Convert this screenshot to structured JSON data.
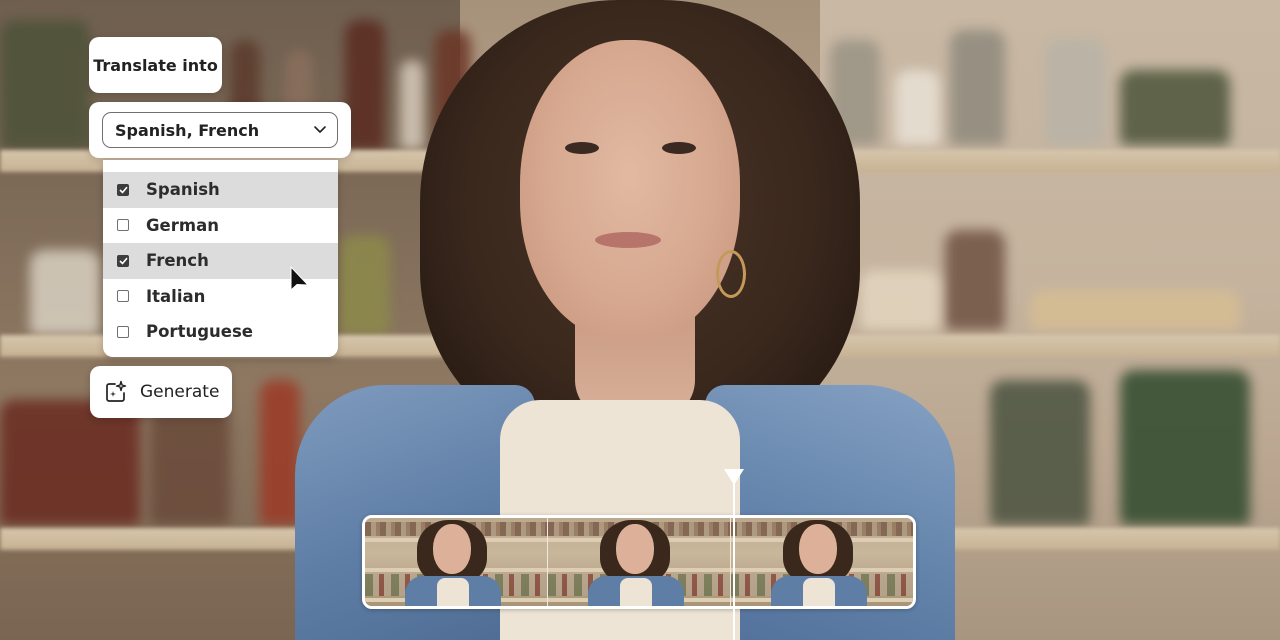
{
  "translate": {
    "label": "Translate into",
    "picker_value": "Spanish, French",
    "picker_icon": "chevron-down-icon",
    "options": [
      {
        "label": "Spanish",
        "checked": true
      },
      {
        "label": "German",
        "checked": false
      },
      {
        "label": "French",
        "checked": true
      },
      {
        "label": "Italian",
        "checked": false
      },
      {
        "label": "Portuguese",
        "checked": false
      }
    ]
  },
  "generate": {
    "label": "Generate",
    "icon": "generative-ai-sparkle-icon"
  },
  "timeline": {
    "frames": [
      {
        "label": "frame-1"
      },
      {
        "label": "frame-2"
      },
      {
        "label": "frame-3"
      }
    ],
    "playhead_icon": "playhead-triangle-icon"
  },
  "colors": {
    "panel_bg": "#ffffff",
    "selected_row_bg": "#dcdcdc",
    "checkbox_checked": "#3d3d3d",
    "text": "#222222"
  }
}
